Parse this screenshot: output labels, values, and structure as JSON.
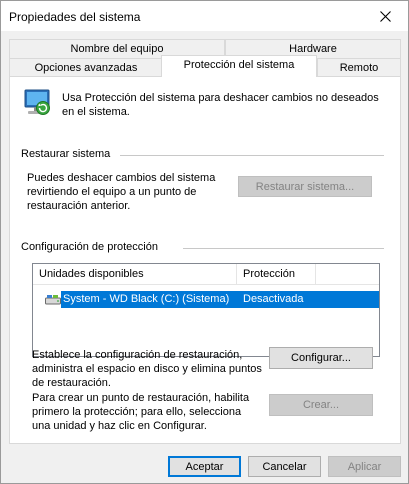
{
  "window": {
    "title": "Propiedades del sistema"
  },
  "tabs": {
    "row_back": [
      {
        "label": "Nombre del equipo"
      },
      {
        "label": "Hardware"
      }
    ],
    "row_front": [
      {
        "label": "Opciones avanzadas"
      },
      {
        "label": "Protección del sistema",
        "selected": true
      },
      {
        "label": "Remoto"
      }
    ]
  },
  "intro": {
    "text": "Usa Protección del sistema para deshacer cambios no deseados en el sistema."
  },
  "restore": {
    "section_title": "Restaurar sistema",
    "description": "Puedes deshacer cambios del sistema revirtiendo el equipo a un punto de restauración anterior.",
    "button_label": "Restaurar sistema..."
  },
  "protection": {
    "section_title": "Configuración de protección",
    "columns": [
      "Unidades disponibles",
      "Protección"
    ],
    "rows": [
      {
        "drive": "System - WD Black (C:) (Sistema)",
        "status": "Desactivada",
        "selected": true
      }
    ],
    "configure_text": "Establece la configuración de restauración, administra el espacio en disco y elimina puntos de restauración.",
    "configure_button": "Configurar...",
    "create_text": "Para crear un punto de restauración, habilita primero la protección; para ello, selecciona una unidad y haz clic en Configurar.",
    "create_button": "Crear..."
  },
  "footer": {
    "accept": "Aceptar",
    "cancel": "Cancelar",
    "apply": "Aplicar"
  },
  "colors": {
    "selection": "#0078d7",
    "accent_border": "#0078d7"
  },
  "icons": {
    "close": "close-icon",
    "system_protection": "system-protection-icon",
    "drive": "hard-drive-icon"
  }
}
